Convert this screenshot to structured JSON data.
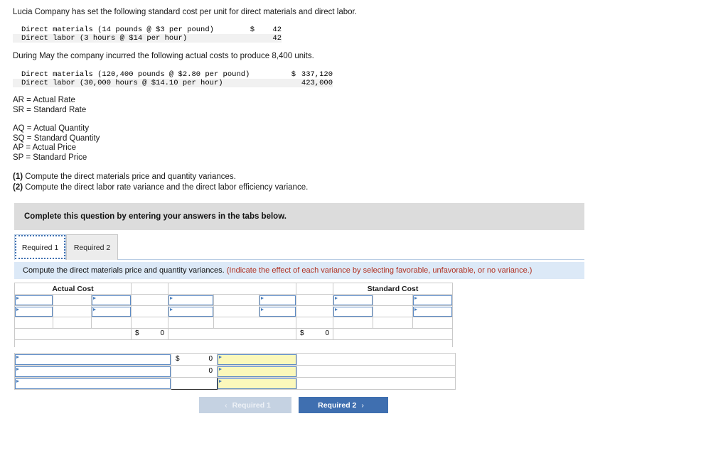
{
  "intro": {
    "line1": "Lucia Company has set the following standard cost per unit for direct materials and direct labor.",
    "line2": "During May the company incurred the following actual costs to produce 8,400 units."
  },
  "standard_costs": [
    {
      "label": "Direct materials (14 pounds @ $3 per pound)",
      "currency": "$",
      "amount": "42"
    },
    {
      "label": "Direct labor (3 hours @ $14 per hour)",
      "currency": "",
      "amount": "42"
    }
  ],
  "actual_costs": [
    {
      "label": "Direct materials (120,400 pounds @ $2.80 per pound)",
      "currency": "$",
      "amount": "337,120"
    },
    {
      "label": "Direct labor (30,000 hours @ $14.10 per hour)",
      "currency": "",
      "amount": "423,000"
    }
  ],
  "definitions_group_a": [
    "AR = Actual Rate",
    "SR = Standard Rate"
  ],
  "definitions_group_b": [
    "AQ = Actual Quantity",
    "SQ = Standard Quantity",
    "AP = Actual Price",
    "SP = Standard Price"
  ],
  "questions": [
    {
      "num": "(1)",
      "text": " Compute the direct materials price and quantity variances."
    },
    {
      "num": "(2)",
      "text": " Compute the direct labor rate variance and the direct labor efficiency variance."
    }
  ],
  "banner": {
    "text": "Complete this question by entering your answers in the tabs below."
  },
  "tabs": [
    {
      "label": "Required 1",
      "active": true
    },
    {
      "label": "Required 2",
      "active": false
    }
  ],
  "instruction": {
    "main": "Compute the direct materials price and quantity variances. ",
    "note": "(Indicate the effect of each variance by selecting favorable, unfavorable, or no variance.)"
  },
  "worksheet": {
    "headers": {
      "actual_cost": "Actual Cost",
      "middle": "",
      "standard_cost": "Standard Cost"
    },
    "totals": {
      "actual": {
        "currency": "$",
        "value": "0"
      },
      "standard": {
        "currency": "$",
        "value": "0"
      }
    },
    "rows": [
      {
        "inputs": [
          "",
          "",
          "",
          "",
          "",
          "",
          "",
          "",
          ""
        ]
      },
      {
        "inputs": [
          "",
          "",
          "",
          "",
          "",
          "",
          "",
          "",
          ""
        ]
      }
    ]
  },
  "variance_rows": [
    {
      "label": "",
      "currency": "$",
      "value": "0",
      "effect": ""
    },
    {
      "label": "",
      "currency": "",
      "value": "0",
      "effect": ""
    },
    {
      "label": "",
      "currency": "",
      "value": "",
      "effect": ""
    }
  ],
  "navigation": {
    "prev_chevron": "‹",
    "prev_label": "Required 1",
    "next_label": "Required 2",
    "next_chevron": "›"
  },
  "colors": {
    "header_blue": "#7ba7db",
    "input_yellow": "#fbf8bb",
    "instruction_bg": "#dce9f7",
    "banner_gray": "#dcdcdc",
    "accent_blue": "#3f6fb0",
    "note_red": "#b03020"
  }
}
